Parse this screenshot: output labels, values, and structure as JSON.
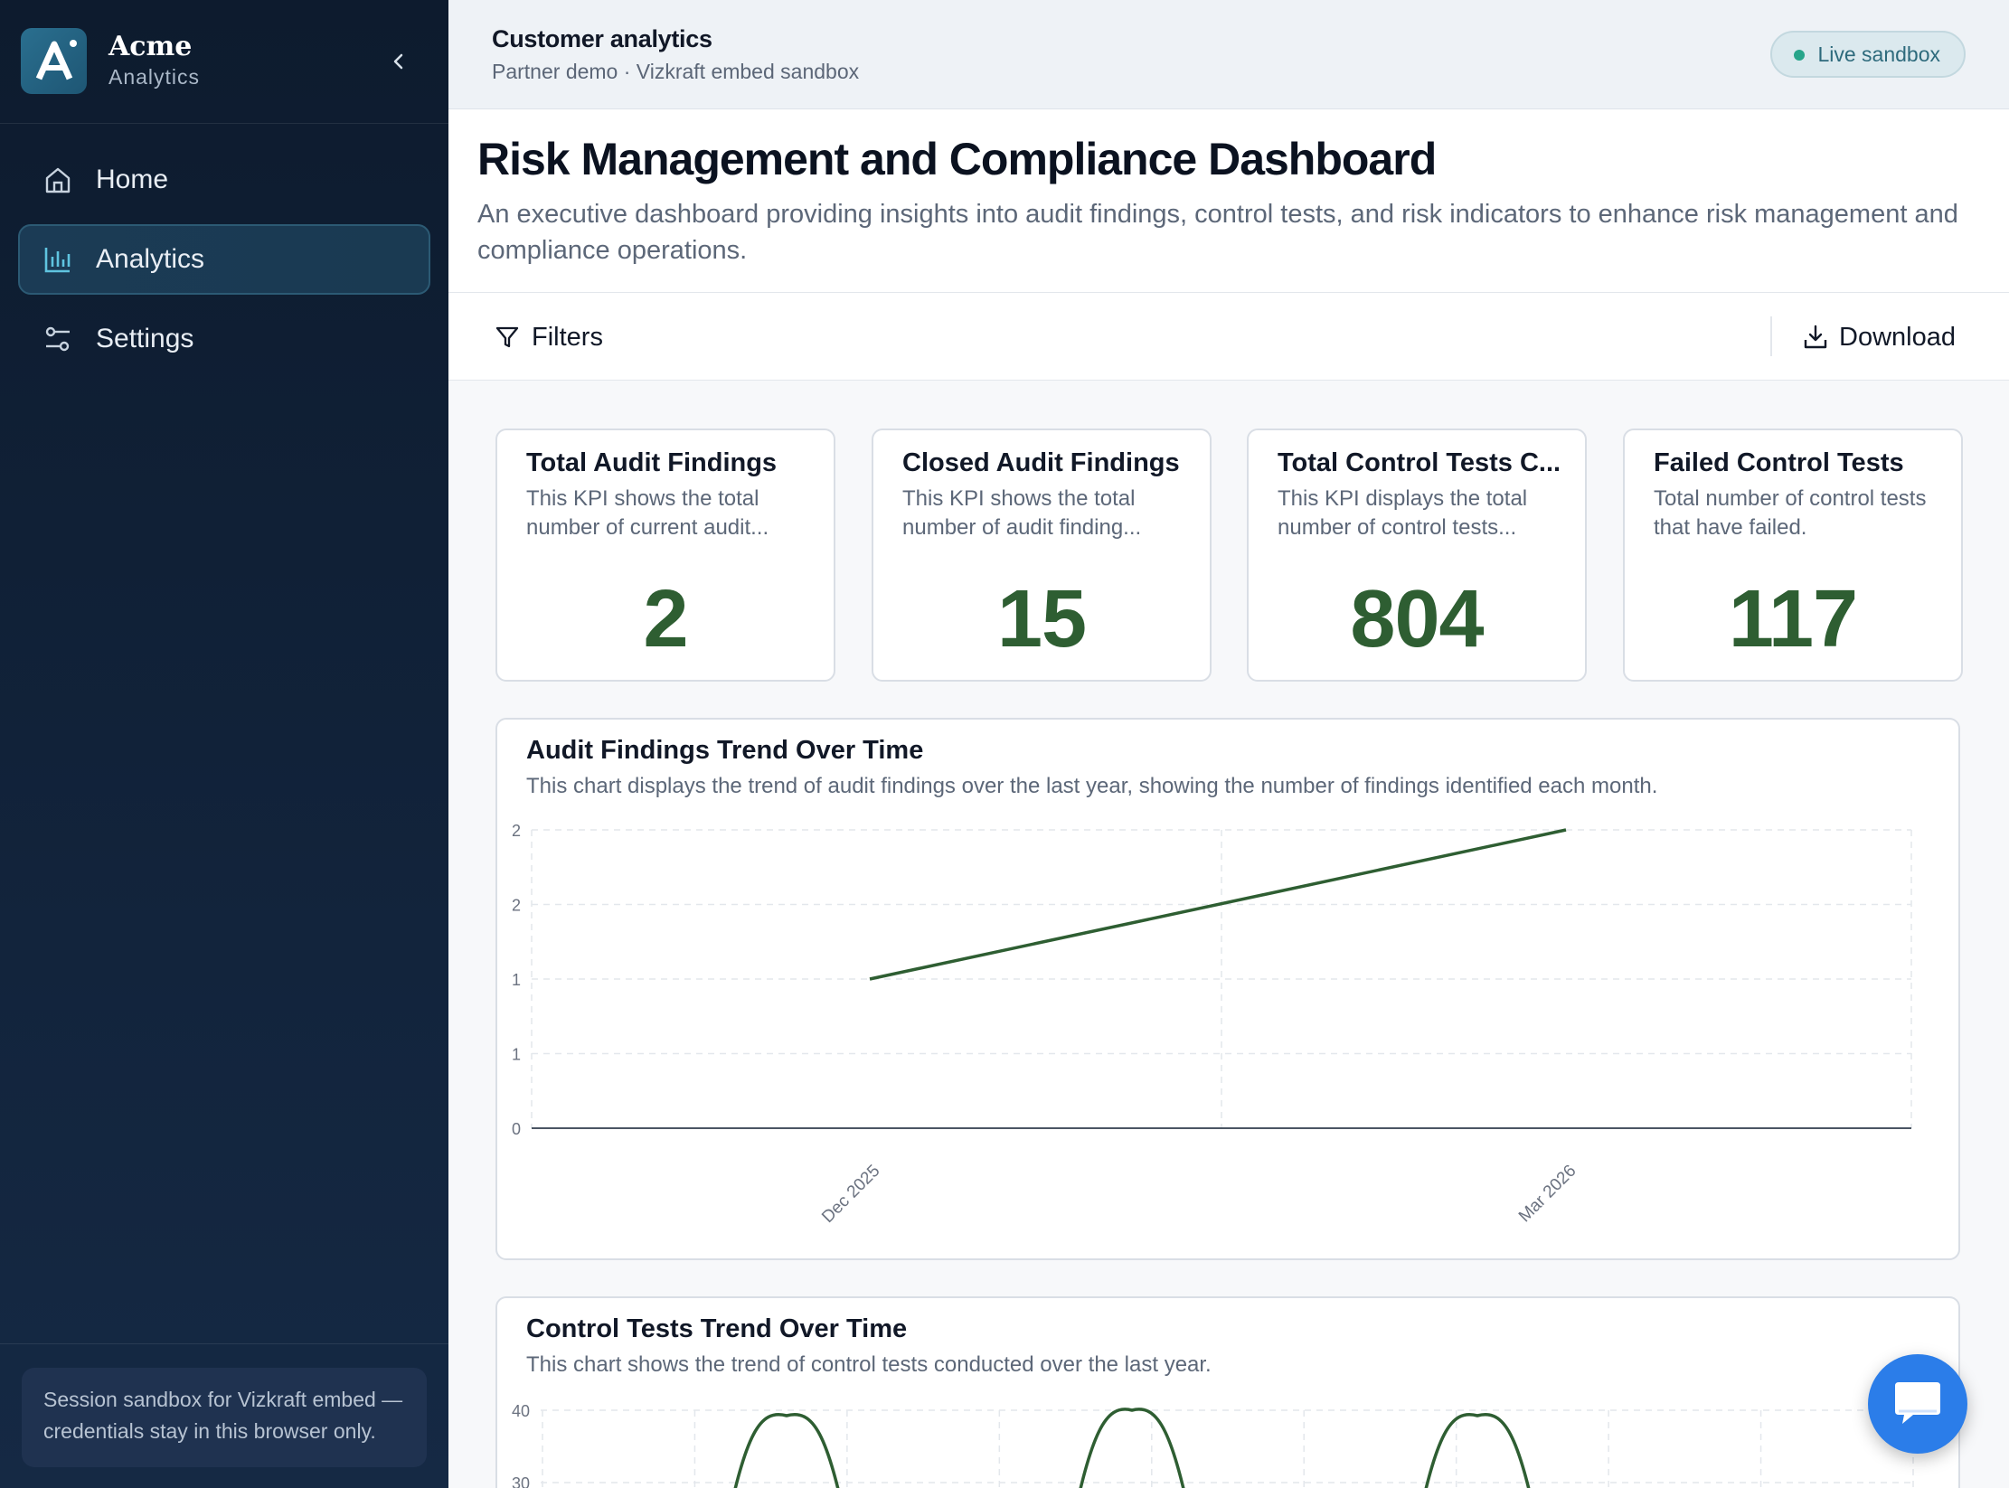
{
  "brand": {
    "name": "Acme",
    "sub": "Analytics",
    "logo_letter": "A"
  },
  "nav": [
    {
      "label": "Home",
      "icon": "home-icon"
    },
    {
      "label": "Analytics",
      "icon": "bar-chart-icon"
    },
    {
      "label": "Settings",
      "icon": "sliders-icon"
    }
  ],
  "session_note": "Session sandbox for Vizkraft embed — credentials stay in this browser only.",
  "topbar": {
    "title": "Customer analytics",
    "subtitle": "Partner demo · Vizkraft embed sandbox",
    "badge": "Live sandbox"
  },
  "page": {
    "title": "Risk Management and Compliance Dashboard",
    "description": "An executive dashboard providing insights into audit findings, control tests, and risk indicators to enhance risk management and compliance operations."
  },
  "toolbar": {
    "filters_label": "Filters",
    "download_label": "Download"
  },
  "kpis": [
    {
      "title": "Total Audit Findings",
      "desc": "This KPI shows the total number of current audit...",
      "value": "2"
    },
    {
      "title": "Closed Audit Findings",
      "desc": "This KPI shows the total number of audit finding...",
      "value": "15"
    },
    {
      "title": "Total Control Tests C...",
      "desc": "This KPI displays the total number of control tests...",
      "value": "804"
    },
    {
      "title": "Failed Control Tests",
      "desc": "Total number of control tests that have failed.",
      "value": "117"
    }
  ],
  "colors": {
    "accent": "#2e5e32",
    "line": "#2e5e32",
    "grid": "#e3e7ec",
    "chat": "#2b7de9"
  },
  "chart_data": [
    {
      "type": "line",
      "title": "Audit Findings Trend Over Time",
      "subtitle": "This chart displays the trend of audit findings over the last year, showing the number of findings identified each month.",
      "x": [
        "Dec 2025",
        "Mar 2026"
      ],
      "y_tick_labels": [
        "0",
        "1",
        "1",
        "2",
        "2"
      ],
      "ylim": [
        0,
        2
      ],
      "series": [
        {
          "x": [
            "Dec 2025",
            "Mar 2026"
          ],
          "values": [
            1,
            2
          ]
        }
      ],
      "grid": true
    },
    {
      "type": "line",
      "title": "Control Tests Trend Over Time",
      "subtitle": "This chart shows the trend of control tests conducted over the last year.",
      "y_tick_labels": [
        "40",
        "30"
      ],
      "grid": true
    }
  ]
}
